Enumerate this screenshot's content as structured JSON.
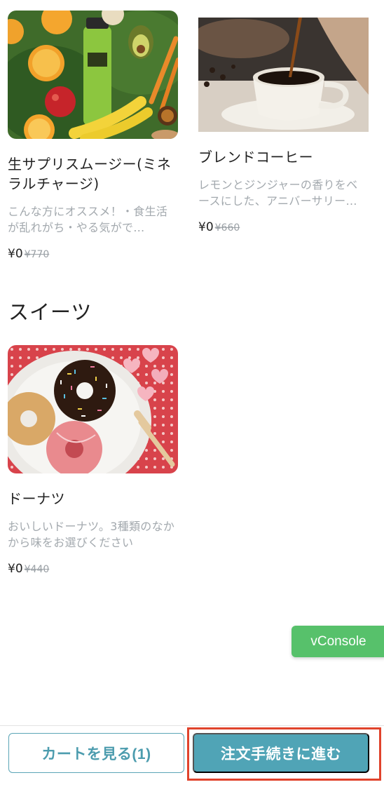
{
  "products_top": [
    {
      "name": "生サプリスムージー(ミネラルチャージ)",
      "description": "こんな方にオススメ！・食生活が乱れがち・やる気がで…",
      "price": "¥0",
      "original_price": "¥770",
      "image": "smoothie-photo"
    },
    {
      "name": "ブレンドコーヒー",
      "description": "レモンとジンジャーの香りをベースにした、アニバーサリー…",
      "price": "¥0",
      "original_price": "¥660",
      "image": "coffee-photo"
    }
  ],
  "section_sweets": {
    "title": "スイーツ",
    "products": [
      {
        "name": "ドーナツ",
        "description": "おいしいドーナツ。3種類のなかから味をお選びください",
        "price": "¥0",
        "original_price": "¥440",
        "image": "donut-photo"
      }
    ]
  },
  "vconsole_label": "vConsole",
  "bottom_bar": {
    "cart_label": "カートを見る(1)",
    "checkout_label": "注文手続きに進む"
  },
  "colors": {
    "accent": "#50a4b6",
    "highlight": "#e0432c",
    "vconsole": "#57c16b"
  }
}
